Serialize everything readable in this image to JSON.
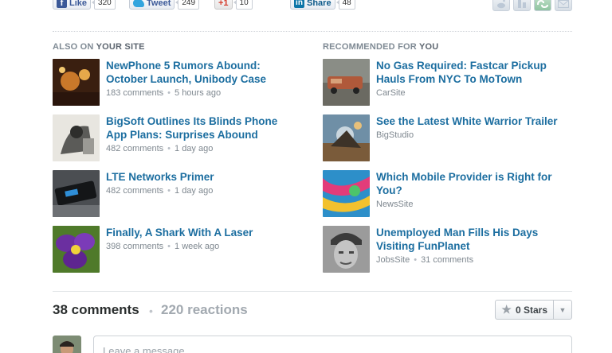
{
  "share": {
    "facebook": {
      "label": "Like",
      "count": "320"
    },
    "twitter": {
      "label": "Tweet",
      "count": "249"
    },
    "google": {
      "label": "+1",
      "count": "10"
    },
    "linkedin": {
      "label": "Share",
      "count": "48"
    }
  },
  "left_column": {
    "header_prefix": "ALSO ON",
    "header_emph": "YOUR SITE",
    "items": [
      {
        "title": "NewPhone 5 Rumors Abound: October Launch, Unibody Case",
        "comments": "183 comments",
        "time": "5 hours ago"
      },
      {
        "title": "BigSoft Outlines Its Blinds Phone App Plans: Surprises Abound",
        "comments": "482 comments",
        "time": "1 day ago"
      },
      {
        "title": "LTE Networks Primer",
        "comments": "482 comments",
        "time": "1 day ago"
      },
      {
        "title": "Finally, A Shark With A Laser",
        "comments": "398 comments",
        "time": "1 week ago"
      }
    ]
  },
  "right_column": {
    "header_prefix": "RECOMMENDED FOR",
    "header_emph": "YOU",
    "items": [
      {
        "title": "No Gas Required: Fastcar Pickup Hauls From NYC To MoTown",
        "source": "CarSite"
      },
      {
        "title": "See the Latest White Warrior Trailer",
        "source": "BigStudio"
      },
      {
        "title": "Which Mobile Provider is Right for You?",
        "source": "NewsSite"
      },
      {
        "title": "Unemployed Man Fills His Days Visiting FunPlanet",
        "source": "JobsSite",
        "comments": "31 comments"
      }
    ]
  },
  "discussion": {
    "comment_count": "38 comments",
    "reactions": "220 reactions",
    "stars_label": "0 Stars"
  },
  "composer": {
    "placeholder": "Leave a message..."
  },
  "colors": {
    "link": "#1c6ea0",
    "muted": "#7f8890"
  }
}
